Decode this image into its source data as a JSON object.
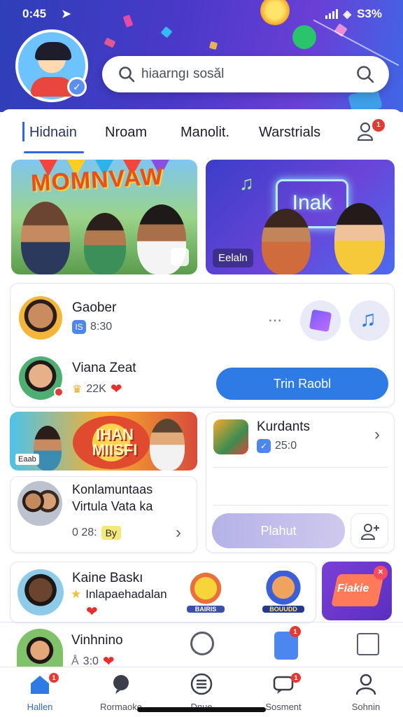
{
  "status_bar": {
    "time": "0:45",
    "battery": "S3%"
  },
  "search": {
    "placeholder": "hiaarngı sosăl"
  },
  "tabs": [
    {
      "label": "Hidnain",
      "active": true
    },
    {
      "label": "Nroam",
      "active": false
    },
    {
      "label": "Manolit.",
      "active": false
    },
    {
      "label": "Warstrials",
      "active": false
    }
  ],
  "friends_badge": "1",
  "banners": {
    "left": {
      "title": "MOMNVAW"
    },
    "right": {
      "neon": "Inak",
      "tag": "Eelaln"
    }
  },
  "contacts": [
    {
      "name": "Gaober",
      "chip": "IS",
      "meta": "8:30"
    },
    {
      "name": "Viana Zeat",
      "meta": "22K"
    }
  ],
  "contact_action": {
    "label": "Trin Raobl"
  },
  "promo": {
    "title": "IHAN MIISFI",
    "tag": "Eaab"
  },
  "kurdants": {
    "name": "Kurdants",
    "meta": "25:0"
  },
  "group": {
    "name_line1": "Konlamuntaas",
    "name_line2": "Virtula Vata ka",
    "meta": "0 28:",
    "tag": "By"
  },
  "plahut_button": {
    "label": "Plahut"
  },
  "kaina": {
    "name": "Kaine Baskı",
    "sub": "Inlapaehadalan",
    "stickers": [
      "BAIRIS",
      "BOUUDD"
    ]
  },
  "promo_small": {
    "label": "Fiakie"
  },
  "vinhnino": {
    "name": "Vinhnino",
    "meta": "3:0"
  },
  "bottom_nav": [
    {
      "label": "Hallen",
      "active": true,
      "badge": "1"
    },
    {
      "label": "Rormaoke",
      "active": false
    },
    {
      "label": "Dnue",
      "active": false
    },
    {
      "label": "Sosment",
      "active": false,
      "badge": "1"
    },
    {
      "label": "Sohnin",
      "active": false
    }
  ],
  "colors": {
    "accent": "#2f7be6",
    "header_start": "#2d3fb8",
    "header_end": "#6a3fd6",
    "badge": "#e53935"
  }
}
